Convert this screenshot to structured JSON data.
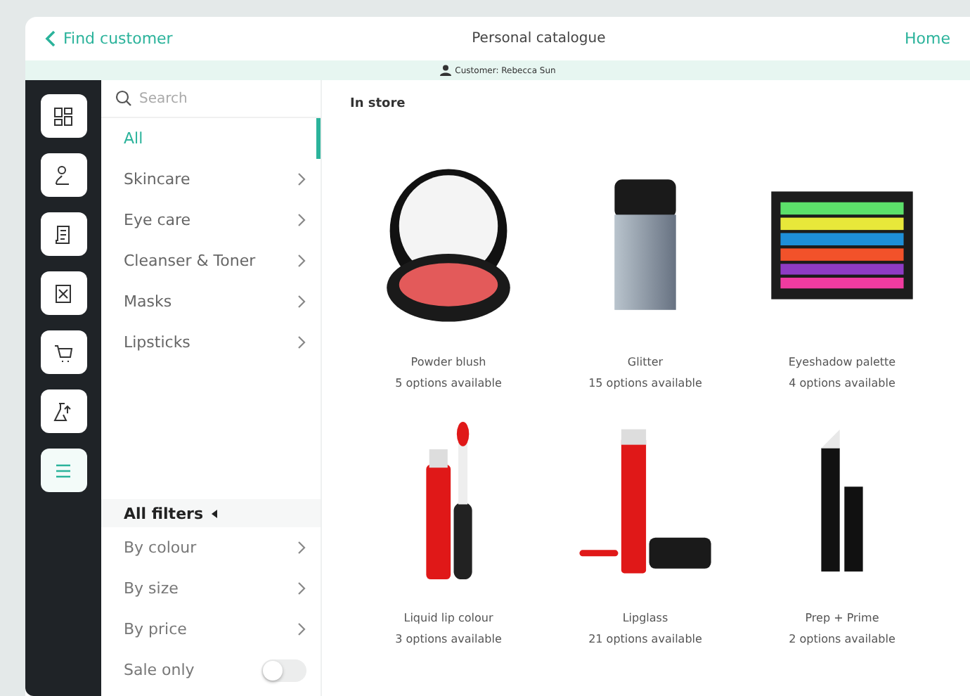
{
  "header": {
    "back_label": "Find customer",
    "title": "Personal catalogue",
    "home_label": "Home"
  },
  "customer_bar": {
    "text": "Customer: Rebecca Sun"
  },
  "rail": [
    {
      "selected": false
    },
    {
      "selected": false
    },
    {
      "selected": false
    },
    {
      "selected": false
    },
    {
      "selected": false
    },
    {
      "selected": false
    },
    {
      "selected": true
    }
  ],
  "search": {
    "placeholder": "Search"
  },
  "categories": [
    {
      "label": "All",
      "selected": true,
      "has_submenu": false
    },
    {
      "label": "Skincare",
      "selected": false,
      "has_submenu": true
    },
    {
      "label": "Eye care",
      "selected": false,
      "has_submenu": true
    },
    {
      "label": "Cleanser & Toner",
      "selected": false,
      "has_submenu": true
    },
    {
      "label": "Masks",
      "selected": false,
      "has_submenu": true
    },
    {
      "label": "Lipsticks",
      "selected": false,
      "has_submenu": true
    }
  ],
  "filters": {
    "title": "All filters",
    "items": [
      {
        "kind": "submenu",
        "label": "By colour"
      },
      {
        "kind": "submenu",
        "label": "By size"
      },
      {
        "kind": "submenu",
        "label": "By price"
      },
      {
        "kind": "toggle",
        "label": "Sale only",
        "on": false
      }
    ]
  },
  "section_title": "In store",
  "products": [
    {
      "kind": "blush",
      "name": "Powder blush",
      "options": "5 options available"
    },
    {
      "kind": "glitter",
      "name": "Glitter",
      "options": "15 options available"
    },
    {
      "kind": "palette",
      "name": "Eyeshadow palette",
      "options": "4 options available"
    },
    {
      "kind": "liquid",
      "name": "Liquid lip colour",
      "options": "3 options available"
    },
    {
      "kind": "lipglass",
      "name": "Lipglass",
      "options": "21 options available"
    },
    {
      "kind": "stick",
      "name": "Prep + Prime",
      "options": "2 options available"
    }
  ]
}
